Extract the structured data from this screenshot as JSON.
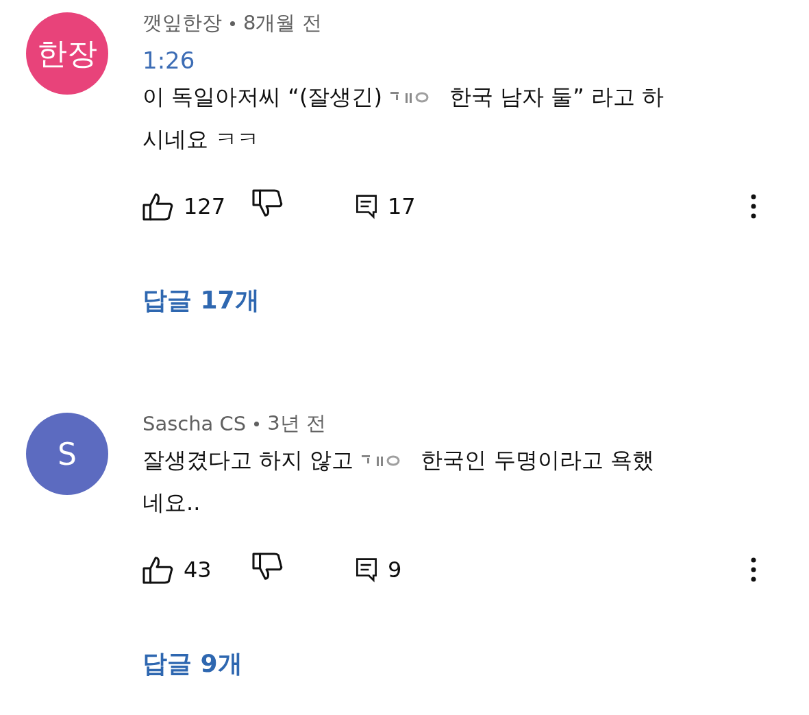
{
  "comments": [
    {
      "avatar": {
        "text": "한장",
        "color": "#e8437a"
      },
      "author": "깻잎한장",
      "age": "8개월 전",
      "timestamp": "1:26",
      "body_before": "이 독일아저씨 “(잘생긴)",
      "body_after": "한국 남자 둘” 라고 하",
      "body_continued": "시네요 ㅋㅋ",
      "likes": "127",
      "replies_count": "17",
      "replies_link": "답글 17개"
    },
    {
      "avatar": {
        "text": "S",
        "color": "#5c6bc0"
      },
      "author": "Sascha CS",
      "age": "3년 전",
      "body_before": "잘생겼다고 하지 않고",
      "body_after": "한국인 두명이라고 욕했",
      "body_continued": "네요..",
      "likes": "43",
      "replies_count": "9",
      "replies_link": "답글 9개"
    }
  ]
}
